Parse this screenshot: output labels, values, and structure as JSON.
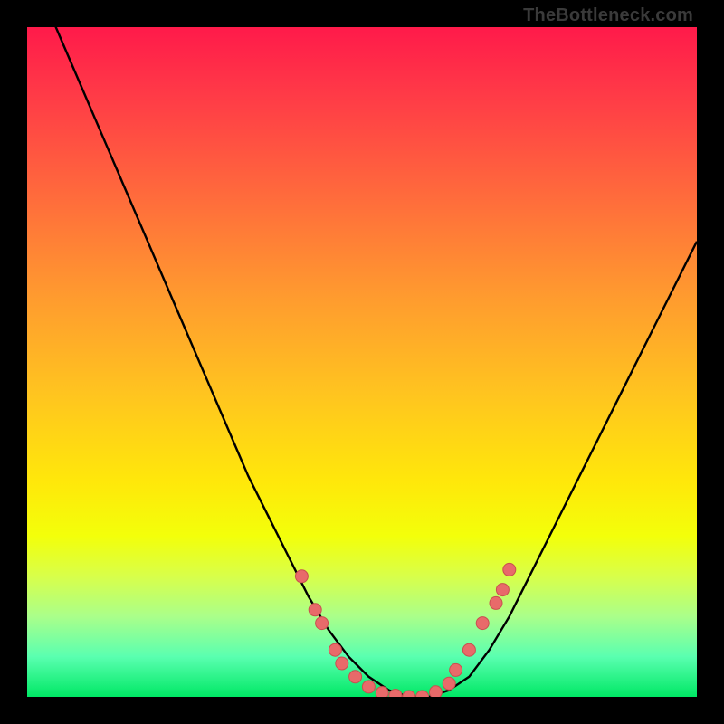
{
  "watermark": "TheBottleneck.com",
  "palette": {
    "curve_stroke": "#000000",
    "marker_fill": "#e86a6a",
    "marker_stroke": "#c94f4f"
  },
  "chart_data": {
    "type": "line",
    "title": "",
    "xlabel": "",
    "ylabel": "",
    "xlim": [
      0,
      100
    ],
    "ylim": [
      0,
      100
    ],
    "grid": false,
    "series": [
      {
        "name": "bottleneck-curve",
        "x": [
          0,
          3,
          6,
          9,
          12,
          15,
          18,
          21,
          24,
          27,
          30,
          33,
          36,
          39,
          42,
          45,
          48,
          51,
          54,
          57,
          60,
          63,
          66,
          69,
          72,
          75,
          78,
          81,
          84,
          87,
          90,
          93,
          96,
          100
        ],
        "y": [
          110,
          103,
          96,
          89,
          82,
          75,
          68,
          61,
          54,
          47,
          40,
          33,
          27,
          21,
          15,
          10,
          6,
          3,
          1,
          0,
          0,
          1,
          3,
          7,
          12,
          18,
          24,
          30,
          36,
          42,
          48,
          54,
          60,
          68
        ]
      }
    ],
    "markers": [
      {
        "x": 41,
        "y": 18
      },
      {
        "x": 43,
        "y": 13
      },
      {
        "x": 44,
        "y": 11
      },
      {
        "x": 46,
        "y": 7
      },
      {
        "x": 47,
        "y": 5
      },
      {
        "x": 49,
        "y": 3
      },
      {
        "x": 51,
        "y": 1.5
      },
      {
        "x": 53,
        "y": 0.6
      },
      {
        "x": 55,
        "y": 0.2
      },
      {
        "x": 57,
        "y": 0
      },
      {
        "x": 59,
        "y": 0
      },
      {
        "x": 61,
        "y": 0.7
      },
      {
        "x": 63,
        "y": 2
      },
      {
        "x": 64,
        "y": 4
      },
      {
        "x": 66,
        "y": 7
      },
      {
        "x": 68,
        "y": 11
      },
      {
        "x": 70,
        "y": 14
      },
      {
        "x": 71,
        "y": 16
      },
      {
        "x": 72,
        "y": 19
      }
    ]
  }
}
